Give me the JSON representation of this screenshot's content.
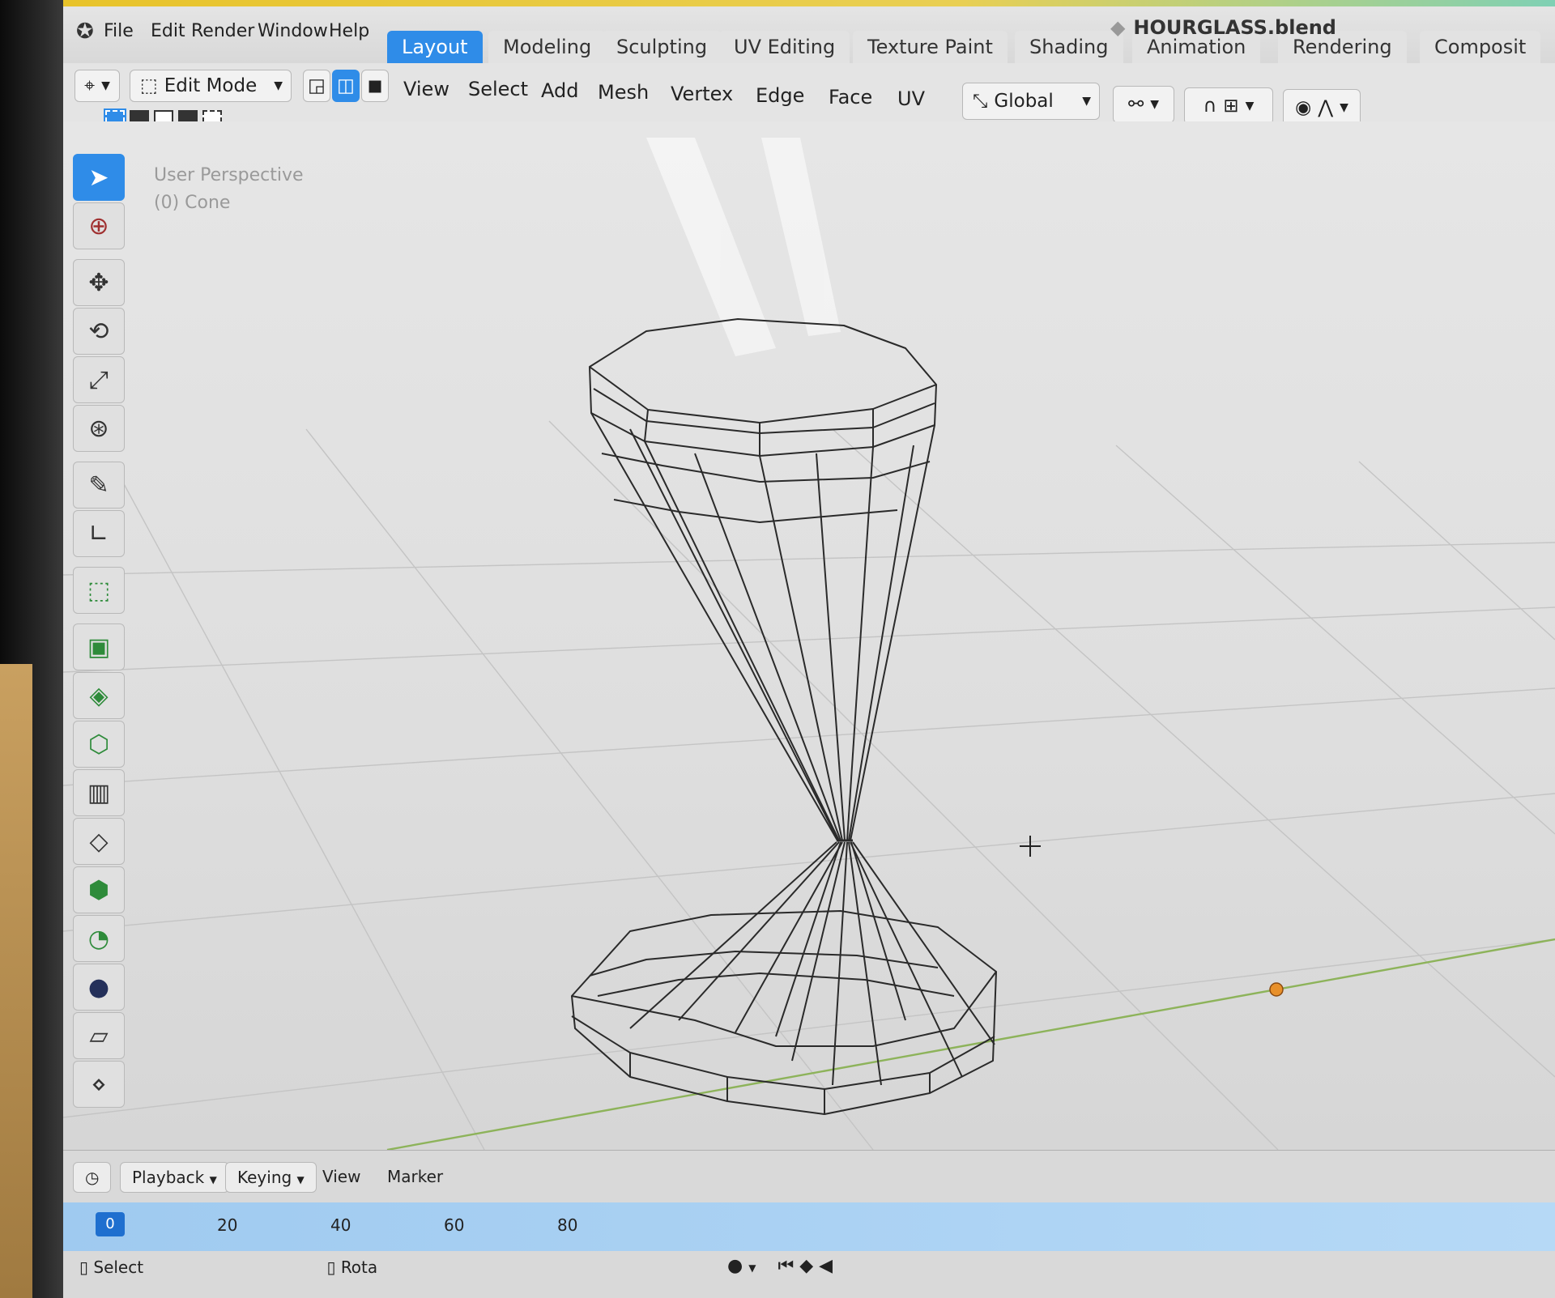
{
  "menu": {
    "file": "File",
    "edit": "Edit",
    "render": "Render",
    "window": "Window",
    "help": "Help"
  },
  "workspaces": [
    "Layout",
    "Modeling",
    "Sculpting",
    "UV Editing",
    "Texture Paint",
    "Shading",
    "Animation",
    "Rendering",
    "Composit"
  ],
  "active_workspace": "Layout",
  "file_title": "HOURGLASS.blend",
  "header": {
    "mode": "Edit Mode",
    "menus": [
      "View",
      "Select",
      "Add",
      "Mesh",
      "Vertex",
      "Edge",
      "Face",
      "UV"
    ],
    "transform_orientation": "Global"
  },
  "viewport": {
    "perspective_label": "User Perspective",
    "object_label": "(0) Cone"
  },
  "timeline": {
    "playback": "Playback",
    "keying": "Keying",
    "view": "View",
    "marker": "Marker",
    "current_frame": "0",
    "ticks": [
      "20",
      "40",
      "60",
      "80"
    ]
  },
  "status": {
    "select": "Select",
    "rotate": "Rota"
  },
  "colors": {
    "accent": "#2f8ce8",
    "title_bar": "#e8c32a",
    "light_point": "#e8902a",
    "y_axis": "#8db35a"
  },
  "icons": [
    "blender-logo-icon",
    "select-box-icon",
    "cursor-icon",
    "move-icon",
    "rotate-icon",
    "scale-icon",
    "transform-icon",
    "annotate-icon",
    "measure-icon",
    "add-cube-icon",
    "extrude-icon",
    "inset-icon",
    "bevel-icon",
    "loop-cut-icon",
    "knife-icon",
    "poly-build-icon",
    "spin-icon",
    "smooth-icon",
    "shear-icon",
    "shrink-icon"
  ]
}
